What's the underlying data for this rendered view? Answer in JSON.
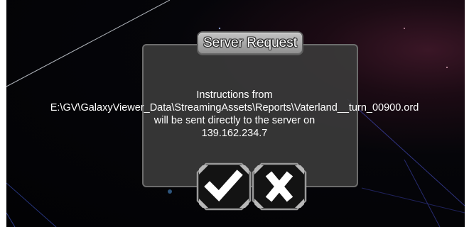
{
  "dialog": {
    "title": "Server Request",
    "message_lines": [
      "Instructions from",
      "E:\\GV\\GalaxyViewer_Data\\StreamingAssets\\Reports\\Vaterland__turn_00900.ord",
      "will be sent directly to the server on",
      "139.162.234.7"
    ],
    "confirm_icon": "checkmark-icon",
    "cancel_icon": "x-icon"
  },
  "colors": {
    "panel": "#3a3a3a",
    "plate": "#a8a8a8",
    "text": "#ffffff",
    "button_face": "#141414",
    "space": "#050509"
  }
}
